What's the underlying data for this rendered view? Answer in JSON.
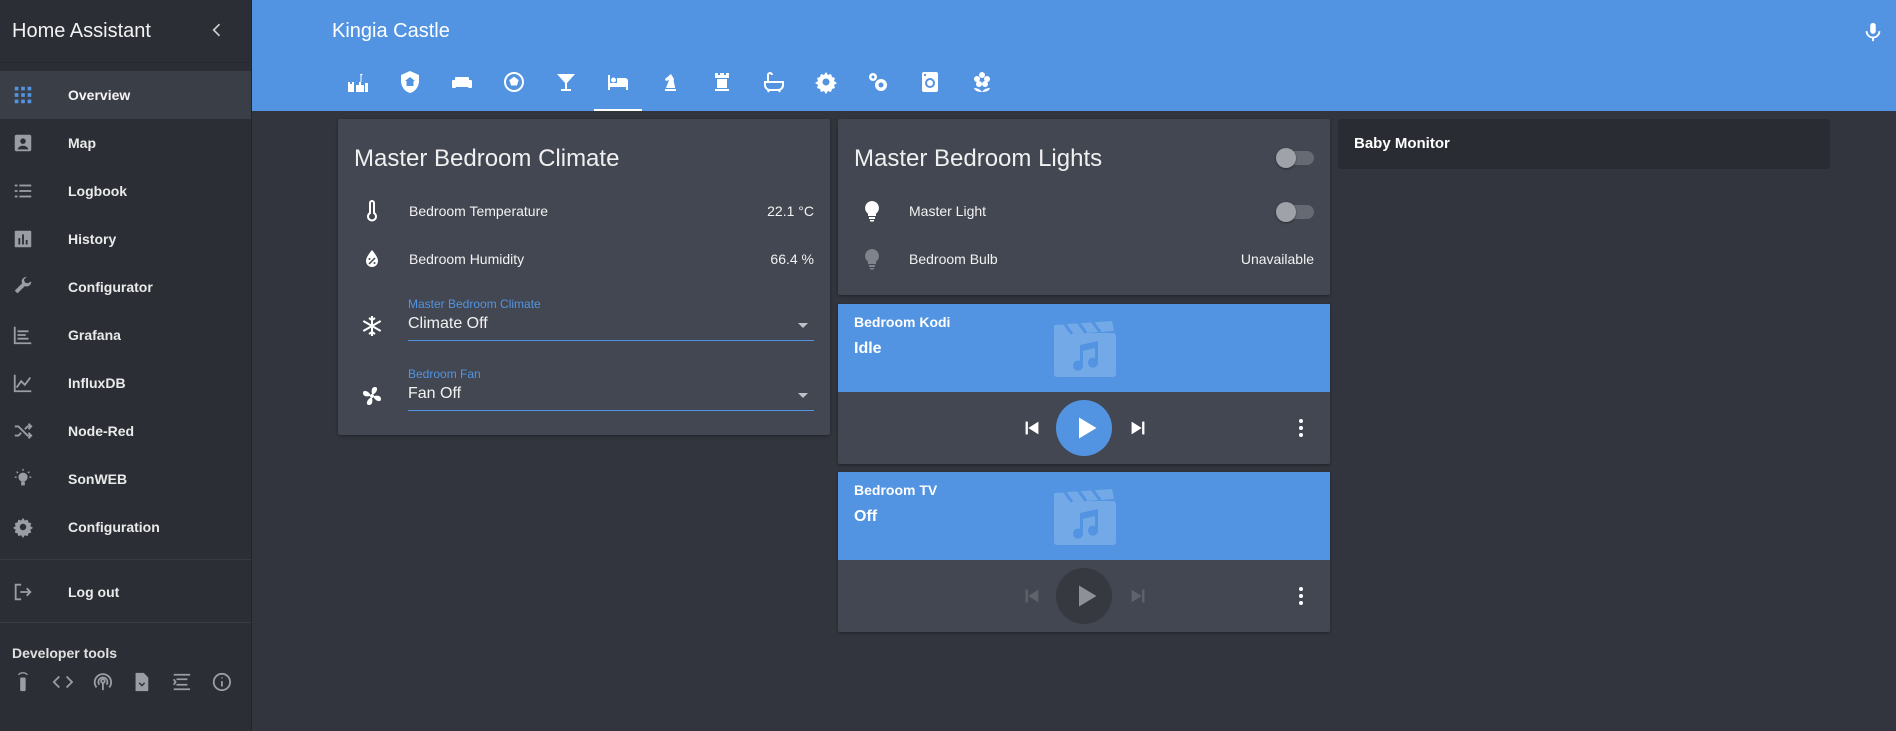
{
  "sidebar": {
    "title": "Home Assistant",
    "items": [
      {
        "label": "Overview",
        "icon": "apps-icon",
        "active": true
      },
      {
        "label": "Map",
        "icon": "account-box-icon"
      },
      {
        "label": "Logbook",
        "icon": "list-icon"
      },
      {
        "label": "History",
        "icon": "chart-bar-icon"
      },
      {
        "label": "Configurator",
        "icon": "wrench-icon"
      },
      {
        "label": "Grafana",
        "icon": "chart-line-icon"
      },
      {
        "label": "InfluxDB",
        "icon": "chart-area-icon"
      },
      {
        "label": "Node-Red",
        "icon": "shuffle-icon"
      },
      {
        "label": "SonWEB",
        "icon": "lightbulb-icon"
      },
      {
        "label": "Configuration",
        "icon": "gear-icon"
      }
    ],
    "logout_label": "Log out",
    "developer_tools_title": "Developer tools",
    "dev_icons": [
      "remote-icon",
      "code-icon",
      "antenna-icon",
      "file-icon",
      "template-icon",
      "info-icon"
    ]
  },
  "header": {
    "title": "Kingia Castle",
    "active_tab_index": 5,
    "tabs": [
      "castle-icon",
      "shield-home-icon",
      "sofa-icon",
      "soccer-icon",
      "cocktail-icon",
      "bed-icon",
      "chess-knight-icon",
      "chess-rook-icon",
      "bathtub-icon",
      "gear-icon",
      "gears-icon",
      "washing-machine-icon",
      "flower-icon"
    ]
  },
  "climate_card": {
    "title": "Master Bedroom Climate",
    "rows": [
      {
        "label": "Bedroom Temperature",
        "value": "22.1 °C",
        "icon": "thermometer-icon"
      },
      {
        "label": "Bedroom Humidity",
        "value": "66.4 %",
        "icon": "water-percent-icon"
      }
    ],
    "selects": [
      {
        "label": "Master Bedroom Climate",
        "value": "Climate Off",
        "icon": "snowflake-icon"
      },
      {
        "label": "Bedroom Fan",
        "value": "Fan Off",
        "icon": "fan-icon"
      }
    ]
  },
  "lights_card": {
    "title": "Master Bedroom Lights",
    "rows": [
      {
        "label": "Master Light",
        "state": "off",
        "icon": "lightbulb-icon"
      },
      {
        "label": "Bedroom Bulb",
        "value": "Unavailable",
        "icon": "lightbulb-icon"
      }
    ]
  },
  "media": [
    {
      "name": "Bedroom Kodi",
      "state": "Idle",
      "enabled": true
    },
    {
      "name": "Bedroom TV",
      "state": "Off",
      "enabled": false
    }
  ],
  "baby_monitor": {
    "title": "Baby Monitor"
  },
  "colors": {
    "accent": "#5294e2",
    "background": "#32353d",
    "card": "#434751",
    "sidebar": "#2b2e35"
  }
}
